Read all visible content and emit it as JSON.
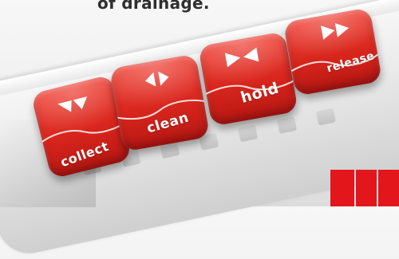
{
  "caption": {
    "text": "of drainage."
  },
  "buttons": [
    {
      "id": "collect",
      "label": "collect",
      "icon": "double-chevron-down-icon"
    },
    {
      "id": "clean",
      "label": "clean",
      "icon": "left-right-arrows-icon"
    },
    {
      "id": "hold",
      "label": "hold",
      "icon": "bowtie-icon"
    },
    {
      "id": "release",
      "label": "release",
      "icon": "fast-forward-icon"
    }
  ],
  "colors": {
    "button_red": "#d8261d",
    "brand_red": "#e3161b",
    "caption_text": "#2f2f2f"
  }
}
